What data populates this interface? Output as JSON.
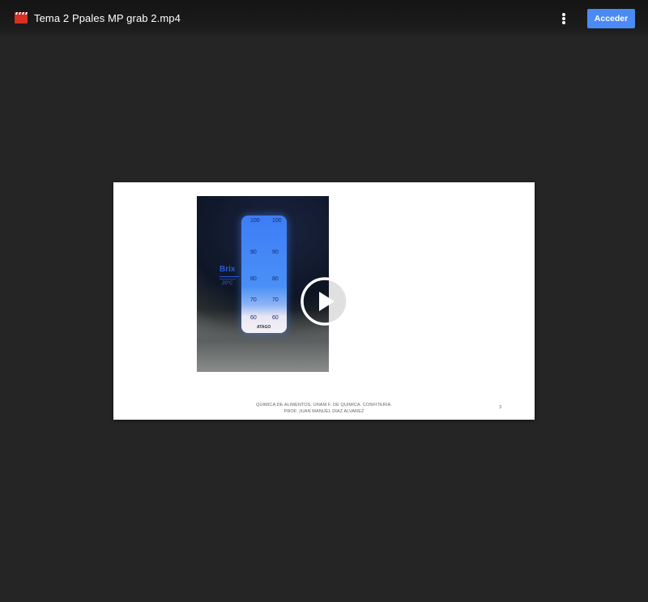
{
  "header": {
    "file_icon": "video-file-icon",
    "file_color": "#d93025",
    "title": "Tema 2 Ppales MP grab 2.mp4",
    "more_icon": "more-vertical-icon",
    "signin_label": "Acceder",
    "signin_color": "#4a8af4"
  },
  "viewer": {
    "background": "#252525",
    "play_icon": "play-circle-icon",
    "slide": {
      "refractometer": {
        "scale_left": [
          "100",
          "90",
          "80",
          "70",
          "60"
        ],
        "scale_right": [
          "100",
          "90",
          "80",
          "70",
          "60"
        ],
        "label": "Brix",
        "temp_label": "20°C",
        "brand": "ATAGO"
      },
      "footer_line1": "QUIMICA DE ALIMENTOS. UNAM F. DE QUIMICA. CONFITERIA.",
      "footer_line2": "PROF. JUAN MANUEL DIAZ ALVAREZ",
      "page_number": "3"
    }
  }
}
